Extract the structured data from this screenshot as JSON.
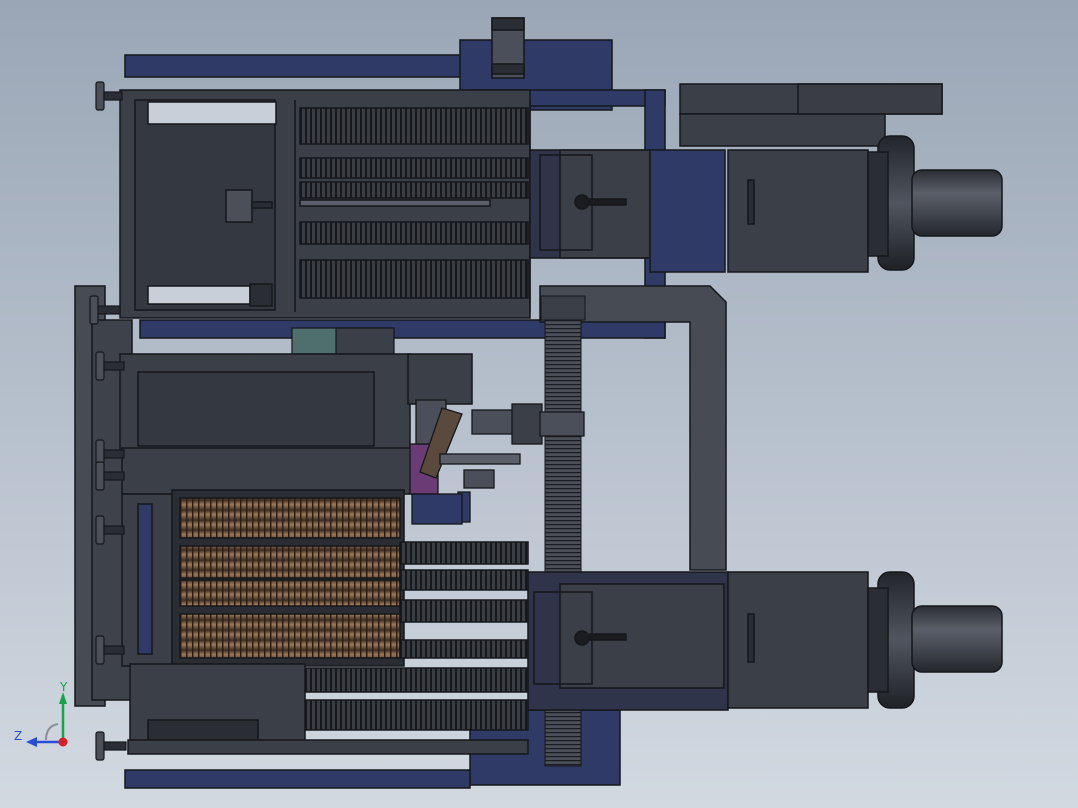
{
  "viewport": {
    "background_top": "#9aa6b6",
    "background_bottom": "#d2d9e1"
  },
  "palette": {
    "frame_steel": "#3b3f47",
    "frame_edge": "#15171b",
    "frame_navy": "#2f3a66",
    "bearing_grey": "#4a4f59",
    "copper_spool": "#8a6a4f",
    "teal_block": "#4f6f6c",
    "purple_part": "#6a3b74"
  },
  "triad": {
    "y_label": "Y",
    "z_label": "Z",
    "y_color": "#16a34a",
    "z_color": "#2b4cd6",
    "x_color": "#d61f26"
  }
}
